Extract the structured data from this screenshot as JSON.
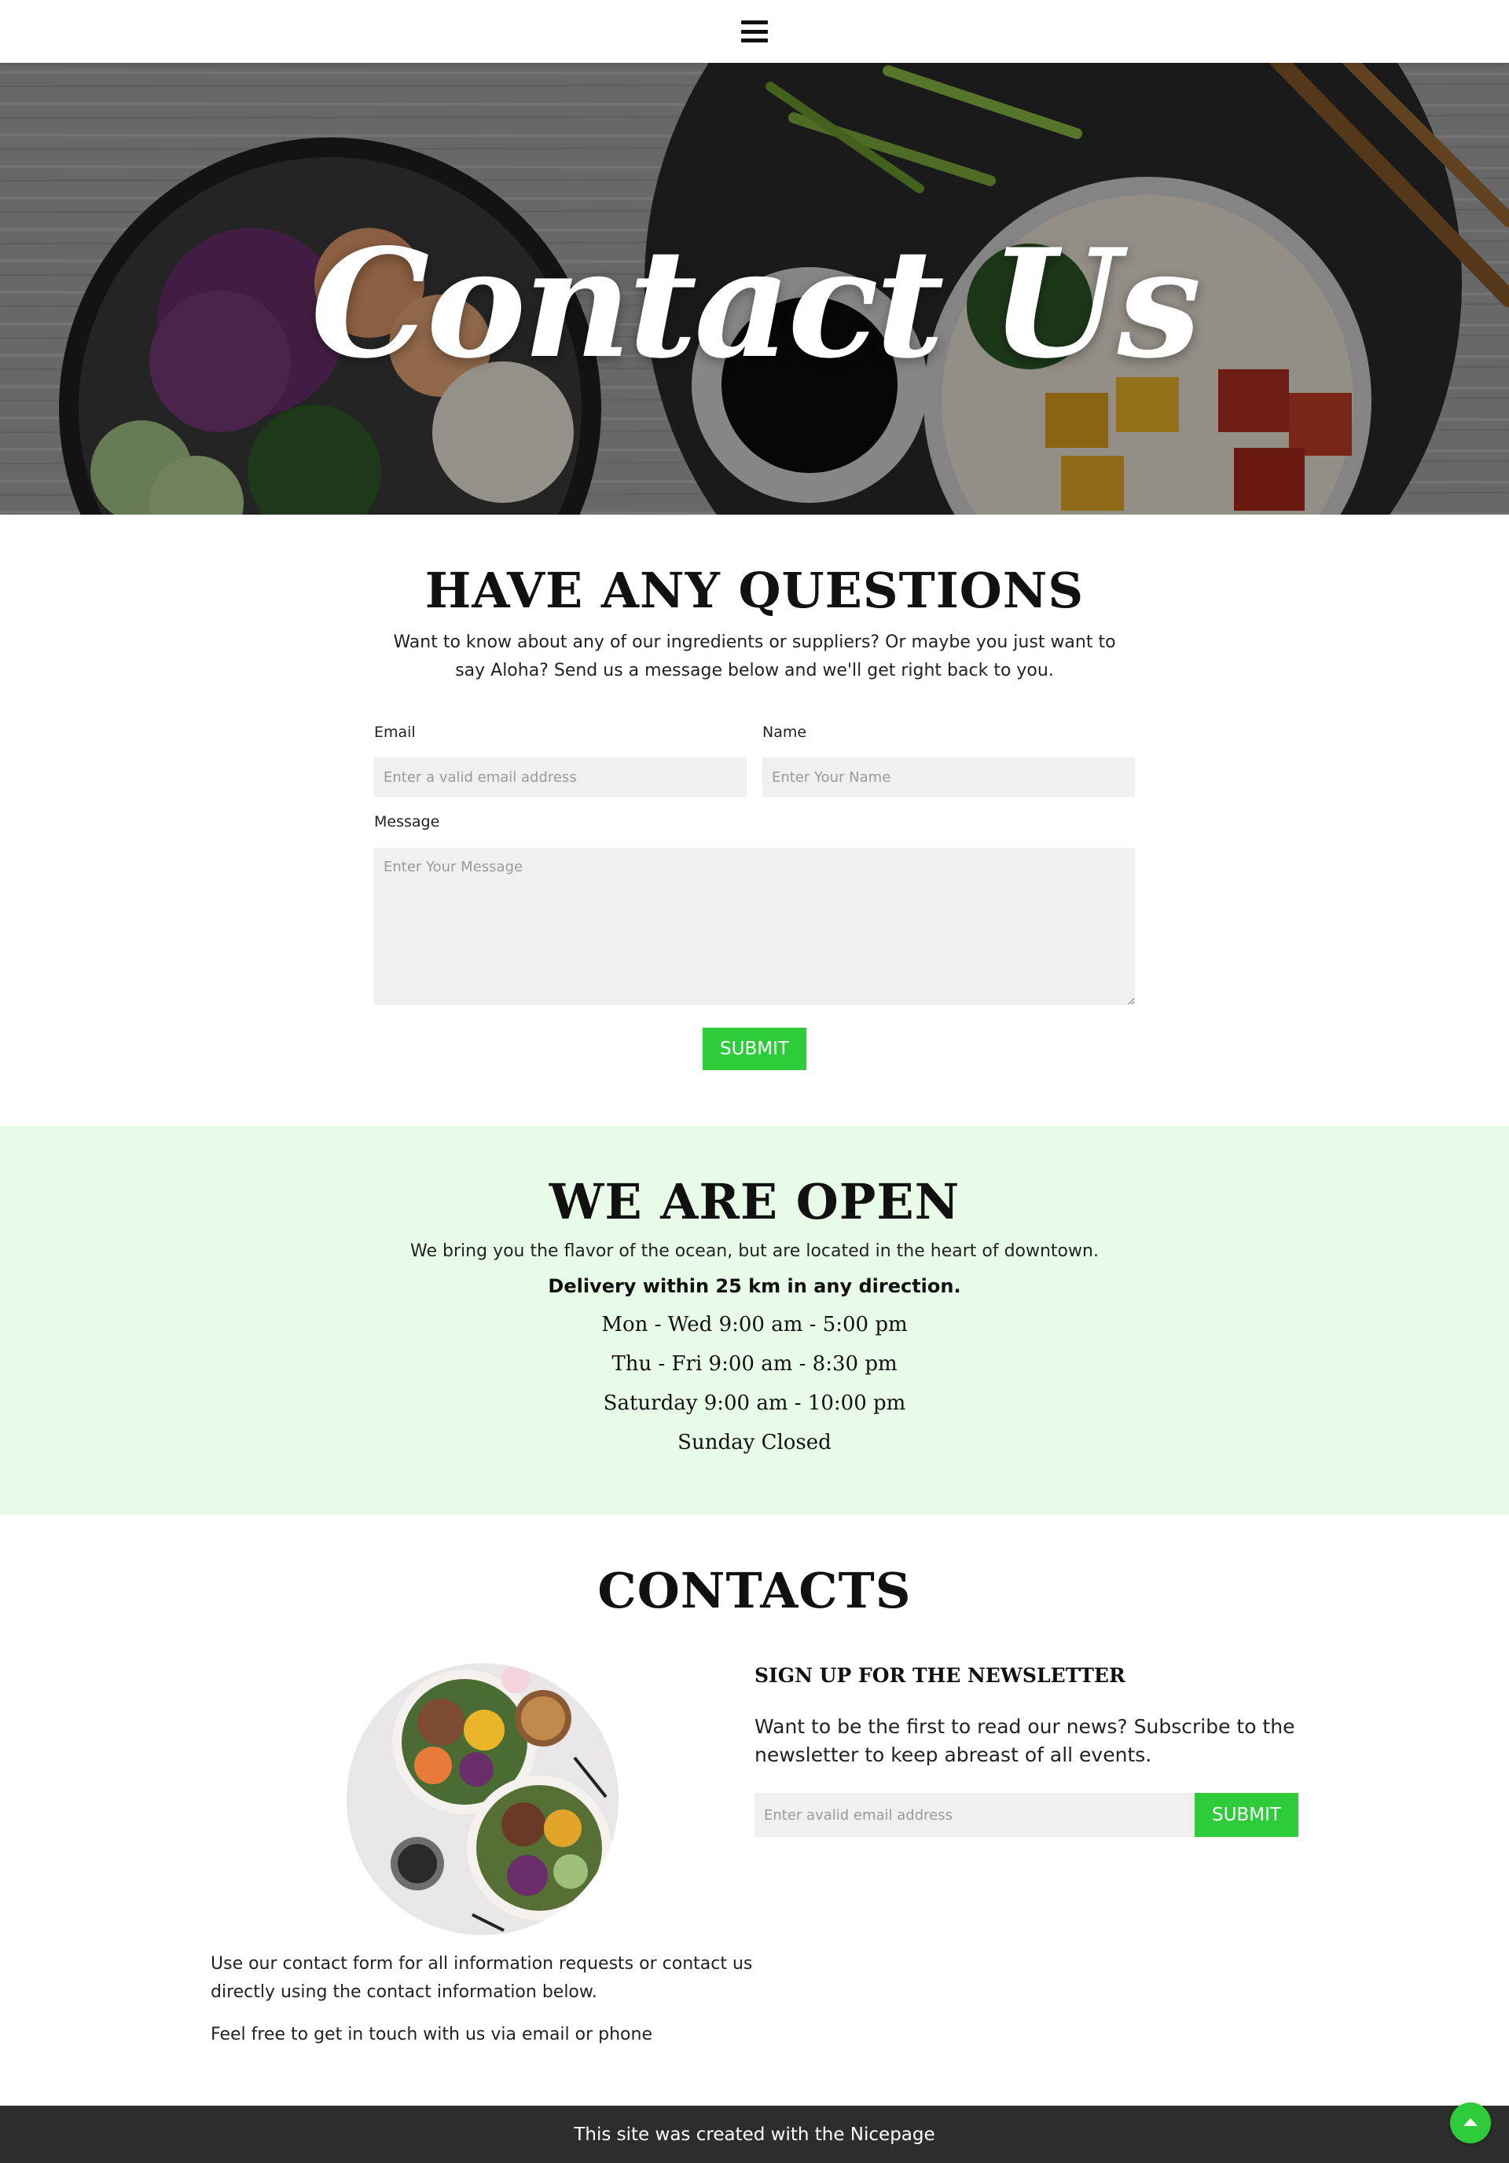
{
  "colors": {
    "accent": "#2ecb3a",
    "open_section_bg": "#e8fbe8",
    "footer_bg": "#2d2d2d",
    "field_bg": "#f0f0f0"
  },
  "header": {
    "menu_icon": "hamburger-menu-icon"
  },
  "hero": {
    "title": "Contact Us"
  },
  "questions": {
    "title": "HAVE ANY QUESTIONS",
    "subtitle": "Want to know about any of our ingredients or suppliers? Or maybe you just want to say Aloha? Send us a message below and we'll get right back to you.",
    "form": {
      "email_label": "Email",
      "email_placeholder": "Enter a valid email address",
      "name_label": "Name",
      "name_placeholder": "Enter Your Name",
      "message_label": "Message",
      "message_placeholder": "Enter Your Message",
      "submit_label": "SUBMIT"
    }
  },
  "open": {
    "title": "WE ARE OPEN",
    "description": "We bring you the flavor of the ocean, but are located in the heart of downtown.",
    "delivery": "Delivery within 25 km in any direction.",
    "hours": [
      "Mon - Wed 9:00 am - 5:00 pm",
      "Thu - Fri 9:00 am - 8:30 pm",
      "Saturday 9:00 am - 10:00 pm",
      "Sunday Closed"
    ]
  },
  "contacts": {
    "title": "CONTACTS",
    "text_1": "Use our contact form for all information requests or contact us directly using the contact information below.",
    "text_2": "Feel free to get in touch with us via email or phone",
    "newsletter": {
      "title": "SIGN UP FOR THE NEWSLETTER",
      "text": "Want to be the first to read our news? Subscribe to the newsletter to keep abreast of all events.",
      "email_placeholder": "Enter avalid email address",
      "submit_label": "SUBMIT"
    }
  },
  "footer": {
    "text": "This site was created with the Nicepage",
    "back_to_top_icon": "arrow-up-icon"
  }
}
